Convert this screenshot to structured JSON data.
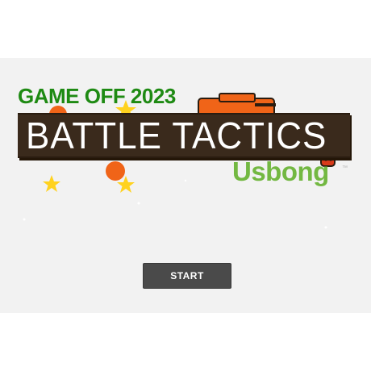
{
  "game": {
    "jam_label": "GAME OFF 2023",
    "title": "BATTLE TACTICS",
    "studio": "Usbong",
    "trademark": "™",
    "start_label": "START"
  },
  "colors": {
    "page_background": "#ffffff",
    "canvas_background": "#f2f2f2",
    "jam_label_green": "#1e8a13",
    "title_banner_brown": "#3a2a1c",
    "title_text_white": "#ffffff",
    "studio_green": "#73b842",
    "orange_accent": "#f06418",
    "star_yellow": "#ffd21f",
    "start_button_gray": "#4a4a4a"
  },
  "icons": {
    "stars": "star-icon",
    "orbs": "orange-orb-icon",
    "tank": "tank-icon",
    "mascot": "mascot-icon"
  }
}
